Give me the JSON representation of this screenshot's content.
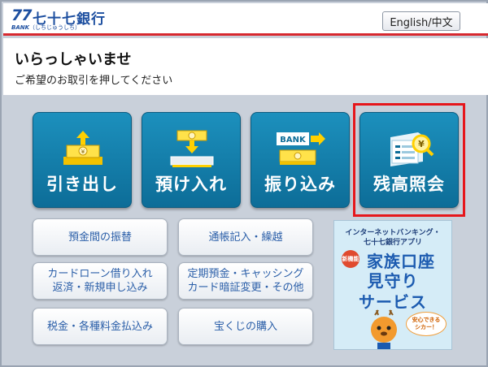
{
  "header": {
    "logo_mark": "77",
    "bank_name": "七十七銀行",
    "logo_sub_en": "BANK",
    "logo_sub_kana": "（しちじゅうしち）",
    "language_button": "English/中文"
  },
  "greeting": {
    "title": "いらっしゃいませ",
    "subtitle": "ご希望のお取引を押してください"
  },
  "main_tiles": [
    {
      "label": "引き出し",
      "icon": "withdraw-icon"
    },
    {
      "label": "預け入れ",
      "icon": "deposit-icon"
    },
    {
      "label": "振り込み",
      "icon": "transfer-icon"
    },
    {
      "label": "残高照会",
      "icon": "balance-inquiry-icon"
    }
  ],
  "transfer_icon_text": "BANK",
  "sub_buttons": {
    "account_transfer": "預金間の振替",
    "passbook": "通帳記入・繰越",
    "card_loan_line1": "カードローン借り入れ",
    "card_loan_line2": "返済・新規申し込み",
    "time_deposit_line1": "定期預金・キャッシング",
    "time_deposit_line2": "カード暗証変更・その他",
    "tax_payment": "税金・各種料金払込み",
    "lottery": "宝くじの購入"
  },
  "banner": {
    "line1": "インターネットバンキング・",
    "line2": "七十七銀行アプリ",
    "badge": "新機能",
    "main1": "家族口座",
    "main2": "見守り",
    "main3": "サービス",
    "bubble1": "安心できる",
    "bubble2": "シカー！"
  },
  "colors": {
    "tile": "#1487b5",
    "accent_red": "#d7282f",
    "brand_blue": "#1d4fa0",
    "highlight": "#e6161b"
  }
}
